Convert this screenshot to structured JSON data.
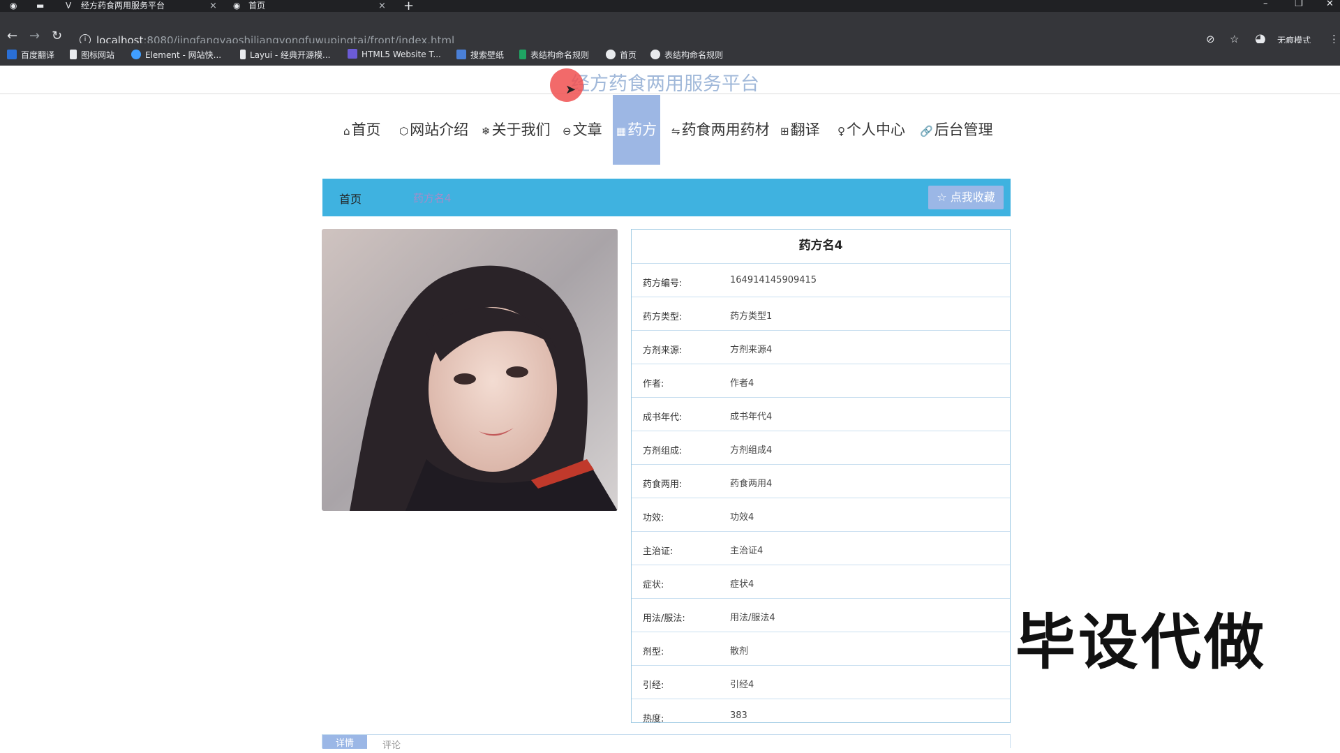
{
  "browser": {
    "tabs": [
      {
        "title": "经方药食两用服务平台",
        "close": "×"
      },
      {
        "title": "首页",
        "close": "×"
      }
    ],
    "new_tab": "+",
    "url_host": "localhost",
    "url_path": ":8080/jingfangyaoshiliangyongfuwupingtai/front/index.html",
    "profile_label": "无痕模式",
    "bookmarks": [
      "百度翻译",
      "图标网站",
      "Element - 网站快...",
      "Layui - 经典开源模...",
      "HTML5 Website T...",
      "搜索壁纸",
      "表结构命名规则",
      "首页",
      "表结构命名规则"
    ]
  },
  "site": {
    "title": "经方药食两用服务平台"
  },
  "nav": {
    "items": [
      {
        "icon": "⌂",
        "label": "首页"
      },
      {
        "icon": "⬡",
        "label": "网站介绍"
      },
      {
        "icon": "❄",
        "label": "关于我们"
      },
      {
        "icon": "⊖",
        "label": "文章"
      },
      {
        "icon": "▦",
        "label": "药方"
      },
      {
        "icon": "⇋",
        "label": "药食两用药材"
      },
      {
        "icon": "⊞",
        "label": "翻译"
      },
      {
        "icon": "♀",
        "label": "个人中心"
      },
      {
        "icon": "🔗",
        "label": "后台管理"
      }
    ],
    "active_index": 4
  },
  "breadcrumb": {
    "home": "首页",
    "current": "药方名4",
    "favorite_button": "☆ 点我收藏"
  },
  "detail": {
    "title": "药方名4",
    "rows": [
      {
        "label": "药方编号:",
        "value": "164914145909415"
      },
      {
        "label": "药方类型:",
        "value": "药方类型1"
      },
      {
        "label": "方剂来源:",
        "value": "方剂来源4"
      },
      {
        "label": "作者:",
        "value": "作者4"
      },
      {
        "label": "成书年代:",
        "value": "成书年代4"
      },
      {
        "label": "方剂组成:",
        "value": "方剂组成4"
      },
      {
        "label": "药食两用:",
        "value": "药食两用4"
      },
      {
        "label": "功效:",
        "value": "功效4"
      },
      {
        "label": "主治证:",
        "value": "主治证4"
      },
      {
        "label": "症状:",
        "value": "症状4"
      },
      {
        "label": "用法/服法:",
        "value": "用法/服法4"
      },
      {
        "label": "剂型:",
        "value": "散剂"
      },
      {
        "label": "引经:",
        "value": "引经4"
      },
      {
        "label": "热度:",
        "value": "383"
      }
    ]
  },
  "watermark": "毕设代做",
  "bottom_tabs": {
    "active": "详情",
    "other": "评论"
  }
}
